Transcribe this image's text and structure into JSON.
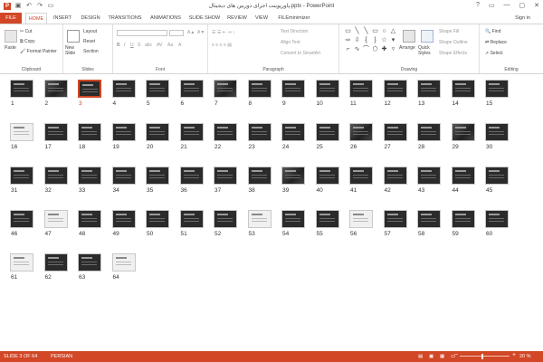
{
  "window": {
    "title": "پاورپوینت اجرای دوربین های دیجیتال.pptx - PowerPoint",
    "sign_in": "Sign in",
    "app_logo": "P",
    "qat_icons": [
      "save-icon",
      "undo-icon",
      "redo-icon",
      "slideshow-icon"
    ],
    "controls": [
      "?",
      "▭",
      "—",
      "▢",
      "✕"
    ]
  },
  "ribbon_tabs": [
    "FILE",
    "HOME",
    "INSERT",
    "DESIGN",
    "TRANSITIONS",
    "ANIMATIONS",
    "SLIDE SHOW",
    "REVIEW",
    "VIEW",
    "FILEminimizer"
  ],
  "active_tab": "HOME",
  "clipboard": {
    "paste": "Paste",
    "cut": "Cut",
    "copy": "Copy",
    "format_painter": "Format Painter",
    "label": "Clipboard"
  },
  "slides": {
    "new_slide": "New Slide",
    "layout": "Layout",
    "reset": "Reset",
    "section": "Section",
    "label": "Slides"
  },
  "font": {
    "label": "Font",
    "bold": "B",
    "italic": "I",
    "underline": "U",
    "strike": "S",
    "shadow": "abc",
    "spacing": "AV",
    "case": "Aa",
    "color": "A"
  },
  "paragraph": {
    "text_direction": "Text Direction",
    "align_text": "Align Text",
    "convert_smartart": "Convert to SmartArt",
    "label": "Paragraph"
  },
  "drawing": {
    "arrange": "Arrange",
    "quick_styles": "Quick Styles",
    "shape_fill": "Shape Fill",
    "shape_outline": "Shape Outline",
    "shape_effects": "Shape Effects",
    "label": "Drawing"
  },
  "editing": {
    "find": "Find",
    "replace": "Replace",
    "select": "Select",
    "label": "Editing"
  },
  "slide_thumbnails": {
    "selected": 3,
    "items": [
      "1",
      "2",
      "3",
      "4",
      "5",
      "6",
      "7",
      "8",
      "9",
      "10",
      "11",
      "12",
      "13",
      "14",
      "15",
      "16",
      "17",
      "18",
      "19",
      "20",
      "21",
      "22",
      "23",
      "24",
      "25",
      "26",
      "27",
      "28",
      "29",
      "30",
      "31",
      "32",
      "33",
      "34",
      "35",
      "36",
      "37",
      "38",
      "39",
      "40",
      "41",
      "42",
      "43",
      "44",
      "45",
      "46",
      "47",
      "48",
      "49",
      "50",
      "51",
      "52",
      "53",
      "54",
      "55",
      "56",
      "57",
      "58",
      "59",
      "60",
      "61",
      "62",
      "63",
      "64"
    ]
  },
  "status": {
    "slide_info": "SLIDE 3 OF 64",
    "language": "PERSIAN",
    "zoom": "20 %"
  },
  "colors": {
    "accent": "#d24726",
    "status_bg": "#d24726"
  }
}
